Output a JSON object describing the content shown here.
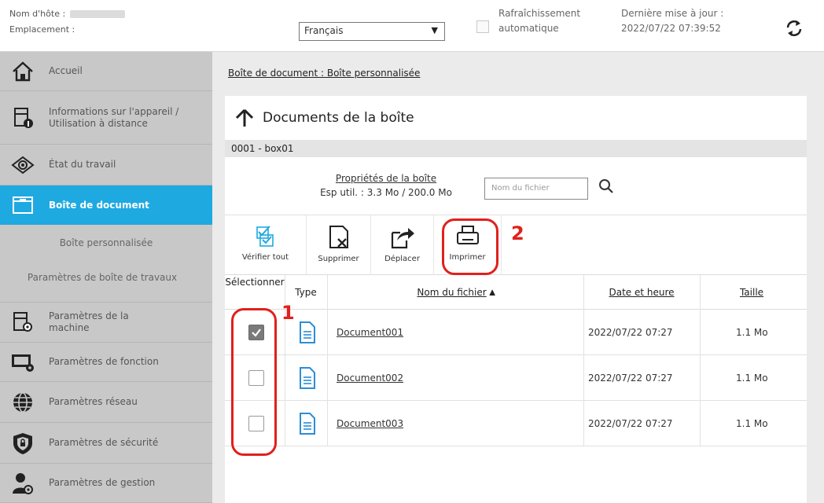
{
  "header": {
    "host_label": "Nom d'hôte :",
    "location_label": "Emplacement :",
    "language": "Français",
    "auto_refresh": [
      "Rafraîchissement",
      "automatique"
    ],
    "last_update_label": "Dernière mise à jour :",
    "last_update_value": "2022/07/22 07:39:52"
  },
  "sidebar": {
    "items": [
      {
        "label": "Accueil",
        "icon": "home-icon"
      },
      {
        "label": "Informations sur l'appareil / Utilisation à distance",
        "icon": "device-info-icon"
      },
      {
        "label": "État du travail",
        "icon": "eye-icon"
      },
      {
        "label": "Boîte de document",
        "icon": "folder-icon"
      },
      {
        "label": "Paramètres de la machine",
        "icon": "machine-settings-icon"
      },
      {
        "label": "Paramètres de fonction",
        "icon": "function-settings-icon"
      },
      {
        "label": "Paramètres réseau",
        "icon": "globe-icon"
      },
      {
        "label": "Paramètres de sécurité",
        "icon": "shield-icon"
      },
      {
        "label": "Paramètres de gestion",
        "icon": "admin-icon"
      }
    ],
    "subitems": [
      {
        "label": "Boîte personnalisée"
      },
      {
        "label": "Paramètres de boîte de travaux"
      }
    ]
  },
  "main": {
    "breadcrumb": "Boîte de document : Boîte personnalisée",
    "title": "Documents de la boîte",
    "box_name": "0001 - box01",
    "properties_link": "Propriétés de la boîte",
    "usage": "Esp util. : 3.3 Mo / 200.0 Mo",
    "search_placeholder": "Nom du fichier",
    "toolbar": {
      "check_all": "Vérifier tout",
      "delete": "Supprimer",
      "move": "Déplacer",
      "print": "Imprimer"
    },
    "columns": {
      "select": "Sélectionner",
      "type": "Type",
      "filename": "Nom du fichier",
      "date": "Date et heure",
      "size": "Taille"
    },
    "rows": [
      {
        "name": "Document001",
        "date": "2022/07/22 07:27",
        "size": "1.1 Mo",
        "checked": true
      },
      {
        "name": "Document002",
        "date": "2022/07/22 07:27",
        "size": "1.1 Mo",
        "checked": false
      },
      {
        "name": "Document003",
        "date": "2022/07/22 07:27",
        "size": "1.1 Mo",
        "checked": false
      }
    ]
  },
  "annotations": {
    "one": "1",
    "two": "2"
  },
  "colors": {
    "accent": "#1ea9e1",
    "sidebar_bg": "#c8c8c8",
    "annotation": "#e0201c"
  }
}
